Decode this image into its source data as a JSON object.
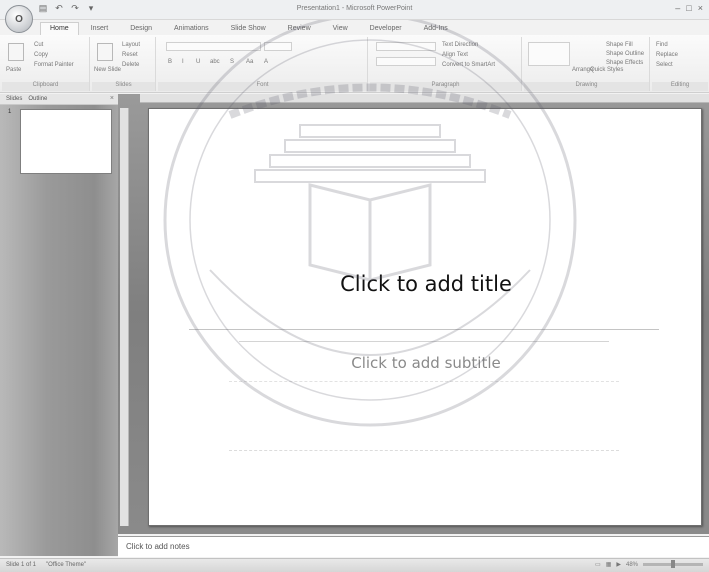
{
  "window": {
    "title": "Presentation1 - Microsoft PowerPoint",
    "office_button": "O",
    "qat": [
      "▤",
      "↶",
      "↷",
      "▾"
    ],
    "controls": [
      "–",
      "□",
      "×"
    ]
  },
  "ribbon": {
    "tabs": [
      "Home",
      "Insert",
      "Design",
      "Animations",
      "Slide Show",
      "Review",
      "View",
      "Developer",
      "Add-Ins"
    ],
    "active_tab": "Home",
    "groups": {
      "clipboard": {
        "label": "Clipboard",
        "items": [
          "Paste",
          "Cut",
          "Copy",
          "Format Painter"
        ]
      },
      "slides": {
        "label": "Slides",
        "items": [
          "Layout",
          "Reset",
          "New Slide",
          "Delete"
        ]
      },
      "font": {
        "label": "Font",
        "items": [
          "B",
          "I",
          "U",
          "abc",
          "S",
          "Aa",
          "A"
        ]
      },
      "paragraph": {
        "label": "Paragraph",
        "items": [
          "Text Direction",
          "Align Text",
          "Convert to SmartArt"
        ]
      },
      "drawing": {
        "label": "Drawing",
        "items": [
          "Arrange",
          "Quick Styles",
          "Shape Fill",
          "Shape Outline",
          "Shape Effects"
        ]
      },
      "editing": {
        "label": "Editing",
        "items": [
          "Find",
          "Replace",
          "Select"
        ]
      }
    }
  },
  "pane": {
    "tabs": [
      "Slides",
      "Outline"
    ],
    "close": "×",
    "slide_number": "1"
  },
  "slide": {
    "title_placeholder": "Click to add title",
    "subtitle_placeholder": "Click to add subtitle"
  },
  "notes": {
    "placeholder": "Click to add notes"
  },
  "status": {
    "slide_info": "Slide 1 of 1",
    "theme": "\"Office Theme\"",
    "zoom": "48%"
  }
}
